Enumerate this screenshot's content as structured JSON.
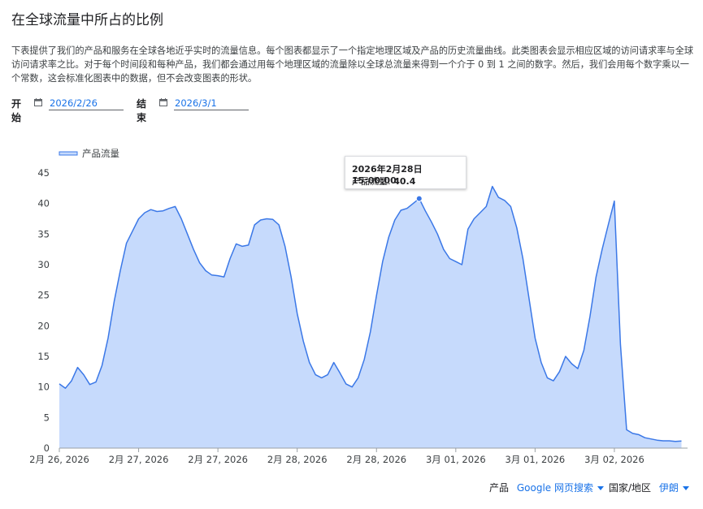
{
  "page": {
    "title": "在全球流量中所占的比例",
    "description": "下表提供了我们的产品和服务在全球各地近乎实时的流量信息。每个图表都显示了一个指定地理区域及产品的历史流量曲线。此类图表会显示相应区域的访问请求率与全球访问请求率之比。对于每个时间段和每种产品，我们都会通过用每个地理区域的流量除以全球总流量来得到一个介于 0 到 1 之间的数字。然后，我们会用每个数字乘以一个常数，这会标准化图表中的数据，但不会改变图表的形状。"
  },
  "controls": {
    "start_label": "开始",
    "start_value": "2026/2/26",
    "end_label": "结束",
    "end_value": "2026/3/1",
    "product_label": "产品",
    "product_value": "Google 网页搜索",
    "region_label": "国家/地区",
    "region_value": "伊朗"
  },
  "tooltip": {
    "time": "2026年2月28日 15:00:00",
    "series_label": "产品流量:",
    "value": "40.4"
  },
  "colors": {
    "line": "#3b78e7",
    "fill": "#c6dafc",
    "accent": "#1a73e8",
    "grid": "#e8eaed"
  },
  "chart_data": {
    "type": "area",
    "legend": [
      "产品流量"
    ],
    "legend_position": "top-left",
    "ylim": [
      0,
      45
    ],
    "yticks": [
      0,
      5,
      10,
      15,
      20,
      25,
      30,
      35,
      40,
      45
    ],
    "xlim": [
      0,
      103
    ],
    "xtick_positions": [
      0,
      13,
      26,
      39,
      52,
      65,
      78,
      91
    ],
    "xtick_labels": [
      "2月 26, 2026",
      "2月 27, 2026",
      "2月 27, 2026",
      "2月 28, 2026",
      "2月 28, 2026",
      "3月 01, 2026",
      "3月 01, 2026",
      "3月 02, 2026"
    ],
    "grid": false,
    "highlight_index": 59,
    "series": [
      {
        "name": "产品流量",
        "values": [
          10.5,
          9.8,
          11,
          13.2,
          12,
          10.4,
          10.8,
          13.5,
          18,
          24,
          29,
          33.5,
          35.5,
          37.5,
          38.5,
          39,
          38.7,
          38.8,
          39.2,
          39.5,
          37.5,
          35,
          32.5,
          30.3,
          29,
          28.3,
          28.2,
          28,
          31,
          33.4,
          33,
          33.2,
          36.5,
          37.3,
          37.5,
          37.4,
          36.5,
          33,
          28,
          22,
          17.5,
          14,
          12,
          11.5,
          12,
          14,
          12.3,
          10.5,
          10,
          11.5,
          14.5,
          19,
          25,
          30.5,
          34.5,
          37.3,
          38.9,
          39.2,
          40,
          40.8,
          38.8,
          37,
          35,
          32.5,
          31,
          30.5,
          30,
          35.8,
          37.5,
          38.5,
          39.5,
          42.8,
          41,
          40.5,
          39.5,
          36,
          31,
          24.5,
          18,
          14,
          11.5,
          11,
          12.5,
          15,
          13.8,
          13,
          16,
          21.5,
          28,
          32.5,
          36.5,
          40.4,
          17,
          3,
          2.4,
          2.2,
          1.7,
          1.5,
          1.3,
          1.2,
          1.2,
          1.1,
          1.15
        ]
      }
    ]
  }
}
